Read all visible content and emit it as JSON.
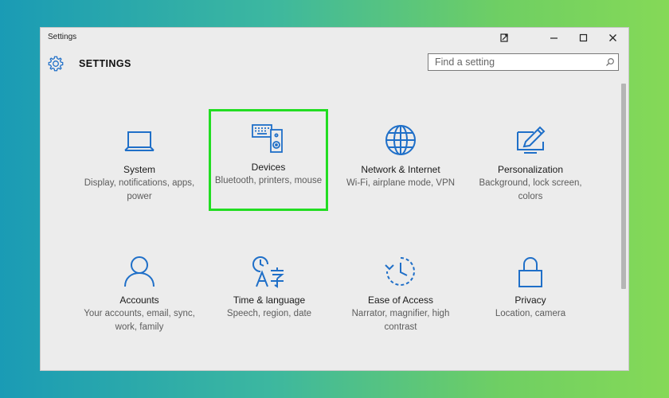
{
  "window": {
    "title": "Settings"
  },
  "header": {
    "title": "SETTINGS",
    "search_placeholder": "Find a setting"
  },
  "colors": {
    "accent": "#1f6fc8",
    "selection": "#22dd22"
  },
  "tiles": [
    {
      "name": "System",
      "desc": "Display, notifications, apps, power",
      "icon": "laptop-icon"
    },
    {
      "name": "Devices",
      "desc": "Bluetooth, printers, mouse",
      "icon": "devices-icon",
      "selected": true
    },
    {
      "name": "Network & Internet",
      "desc": "Wi-Fi, airplane mode, VPN",
      "icon": "globe-icon"
    },
    {
      "name": "Personalization",
      "desc": "Background, lock screen, colors",
      "icon": "paint-icon"
    },
    {
      "name": "Accounts",
      "desc": "Your accounts, email, sync, work, family",
      "icon": "person-icon"
    },
    {
      "name": "Time & language",
      "desc": "Speech, region, date",
      "icon": "time-language-icon"
    },
    {
      "name": "Ease of Access",
      "desc": "Narrator, magnifier, high contrast",
      "icon": "ease-of-access-icon"
    },
    {
      "name": "Privacy",
      "desc": "Location, camera",
      "icon": "lock-icon"
    }
  ]
}
